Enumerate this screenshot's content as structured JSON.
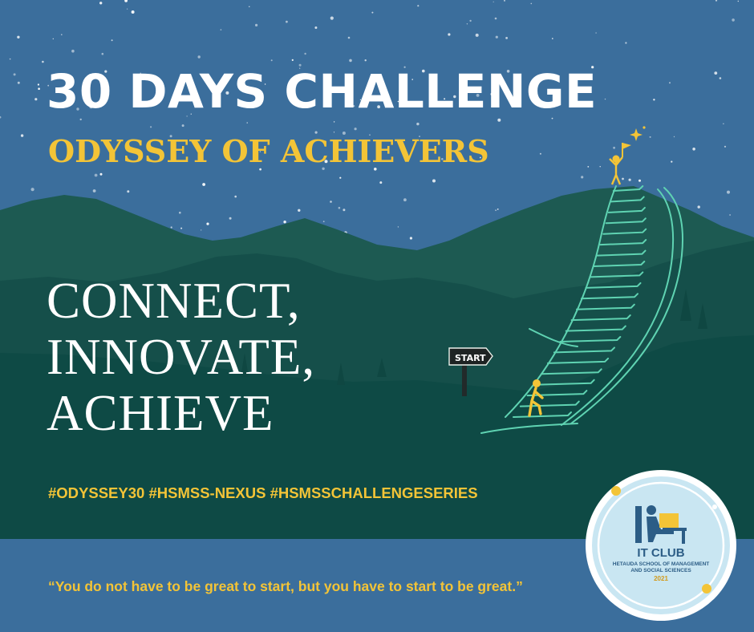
{
  "poster": {
    "title": "30 DAYS CHALLENGE",
    "subtitle": "ODYSSEY OF ACHIEVERS",
    "motto": [
      "CONNECT,",
      "INNOVATE,",
      "ACHIEVE"
    ],
    "hashtags": "#ODYSSEY30 #HSMSS-NEXUS #HSMSSCHALLENGESERIES",
    "quote": "“You do not have to be great to start, but you have to start to be great.”"
  },
  "illustration": {
    "signpost_label": "START",
    "icons": [
      "flag-icon",
      "sparkle-icon",
      "climber-icon",
      "summit-person-icon"
    ]
  },
  "logo": {
    "name": "IT CLUB",
    "org_line1": "HETAUDA SCHOOL OF MANAGEMENT",
    "org_line2": "AND SOCIAL SCIENCES",
    "year": "2021"
  },
  "colors": {
    "sky": "#3b6e9c",
    "mountain_back": "#1d5a52",
    "mountain_front": "#0e4a45",
    "footer_band": "#3b6e9c",
    "accent_yellow": "#f3c437",
    "stair_line": "#5fd3b2",
    "text_white": "#ffffff"
  }
}
